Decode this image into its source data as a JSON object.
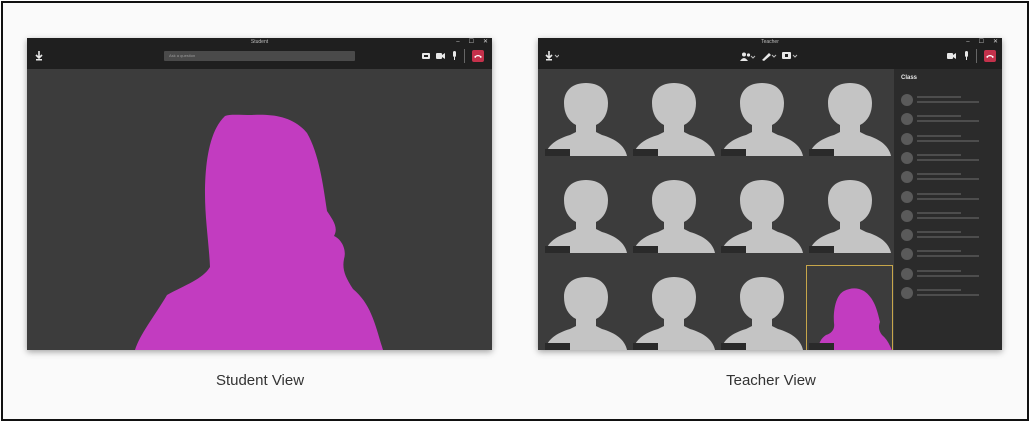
{
  "student": {
    "window_title": "Student",
    "search_placeholder": "Ask a question",
    "caption": "Student View"
  },
  "teacher": {
    "window_title": "Teacher",
    "panel_title": "Class",
    "caption": "Teacher View",
    "tiles": 12,
    "highlighted_tile": 12,
    "roster_rows": 11
  },
  "window_controls": {
    "minimize": "–",
    "maximize": "☐",
    "close": "✕"
  },
  "icons": {
    "raise_hand": "raise-hand-icon",
    "participants": "participants-icon",
    "pen": "pen-icon",
    "whiteboard": "whiteboard-icon",
    "camera": "camera-icon",
    "microphone": "microphone-icon",
    "hang_up": "hang-up-icon",
    "share": "share-icon"
  },
  "colors": {
    "presenter_silhouette": "#c23cc0",
    "participant_silhouette": "#c4c4c4",
    "hang_up": "#c4314b",
    "active_tile_border": "#c7a64a",
    "stage_background": "#3c3c3c",
    "titlebar": "#1f1f1f"
  }
}
